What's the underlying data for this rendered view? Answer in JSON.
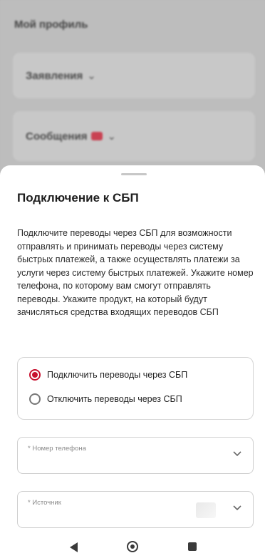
{
  "background": {
    "title": "Мой профиль",
    "cards": [
      {
        "label": "Заявления"
      },
      {
        "label": "Сообщения"
      }
    ]
  },
  "sheet": {
    "title": "Подключение к СБП",
    "description": "Подключите переводы через СБП для возможности отправлять и принимать переводы через систему быстрых платежей, а также осуществлять платежи за услуги через систему быстрых платежей. Укажите номер телефона, по которому вам смогут отправлять переводы. Укажите продукт, на который будут зачисляться средства входящих переводов СБП",
    "options": [
      {
        "label": "Подключить переводы через СБП",
        "selected": true
      },
      {
        "label": "Отключить переводы через СБП",
        "selected": false
      }
    ],
    "fields": {
      "phone_label": "* Номер телефона",
      "source_label": "* Источник"
    }
  },
  "colors": {
    "accent": "#c8102e",
    "overlay": "#bdbdbd"
  },
  "icons": {
    "chevron": "chevron-down-icon",
    "nav_back": "back-icon",
    "nav_home": "home-icon",
    "nav_recent": "recents-icon"
  }
}
